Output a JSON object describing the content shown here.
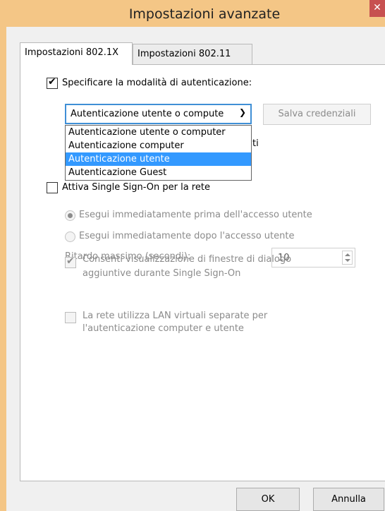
{
  "window": {
    "title": "Impostazioni avanzate",
    "close_glyph": "✕"
  },
  "tabs": [
    {
      "label": "Impostazioni 802.1X",
      "active": true
    },
    {
      "label": "Impostazioni 802.11",
      "active": false
    }
  ],
  "auth": {
    "checkbox_label": "Specificare la modalità di autenticazione:",
    "checked": true,
    "selected_mode": "Autenticazione utente o compute",
    "options": [
      "Autenticazione utente o computer",
      "Autenticazione computer",
      "Autenticazione utente",
      "Autenticazione Guest"
    ],
    "highlighted_option": "Autenticazione utente",
    "save_credentials_label": "Salva credenziali",
    "hidden_suffix": "ti"
  },
  "sso": {
    "checkbox_label": "Attiva Single Sign-On per la rete",
    "checked": false,
    "radio_before": "Esegui immediatamente prima dell'accesso utente",
    "radio_after": "Esegui immediatamente dopo l'accesso utente",
    "delay_label": "Ritardo massimo (secondi):",
    "delay_value": "10",
    "allow_dialogs_line1": "Consenti visualizzazione di finestre di dialogo",
    "allow_dialogs_line2": "aggiuntive durante Single Sign-On",
    "allow_dialogs_checked": true,
    "vlan_line1": "La rete utilizza LAN virtuali separate per",
    "vlan_line2": "l'autenticazione computer e utente",
    "vlan_checked": false
  },
  "buttons": {
    "ok": "OK",
    "cancel": "Annulla"
  },
  "icons": {
    "check": "check-icon",
    "close": "close-icon",
    "chevron": "chevron-down-icon"
  },
  "colors": {
    "titlebar": "#f4c686",
    "selection": "#3399ff",
    "combo_border": "#3f8fd6"
  }
}
